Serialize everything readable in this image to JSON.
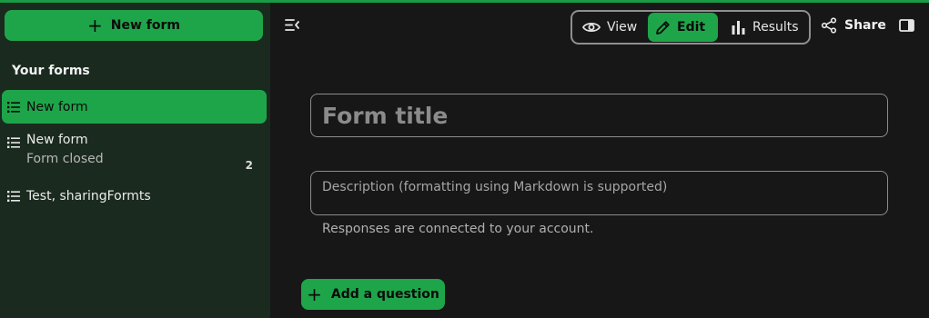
{
  "sidebar": {
    "new_form_label": "New form",
    "caption": "Your forms",
    "forms": [
      {
        "title": "New form",
        "subtitle": "",
        "count": "",
        "active": true
      },
      {
        "title": "New form",
        "subtitle": "Form closed",
        "count": "2",
        "active": false
      },
      {
        "title": "Test, sharingFormts",
        "subtitle": "",
        "count": "",
        "active": false
      }
    ]
  },
  "header": {
    "modes": [
      {
        "label": "View",
        "icon": "eye-icon"
      },
      {
        "label": "Edit",
        "icon": "pencil-icon",
        "active": true
      },
      {
        "label": "Results",
        "icon": "bar-chart-icon"
      }
    ],
    "share_label": "Share"
  },
  "form": {
    "title_placeholder": "Form title",
    "description_placeholder": "Description (formatting using Markdown is supported)",
    "responses_note": "Responses are connected to your account.",
    "add_question_label": "Add a question"
  },
  "colors": {
    "accent": "#1ea54a",
    "sidebar_bg": "#1a2a1f",
    "main_bg": "#171717"
  }
}
